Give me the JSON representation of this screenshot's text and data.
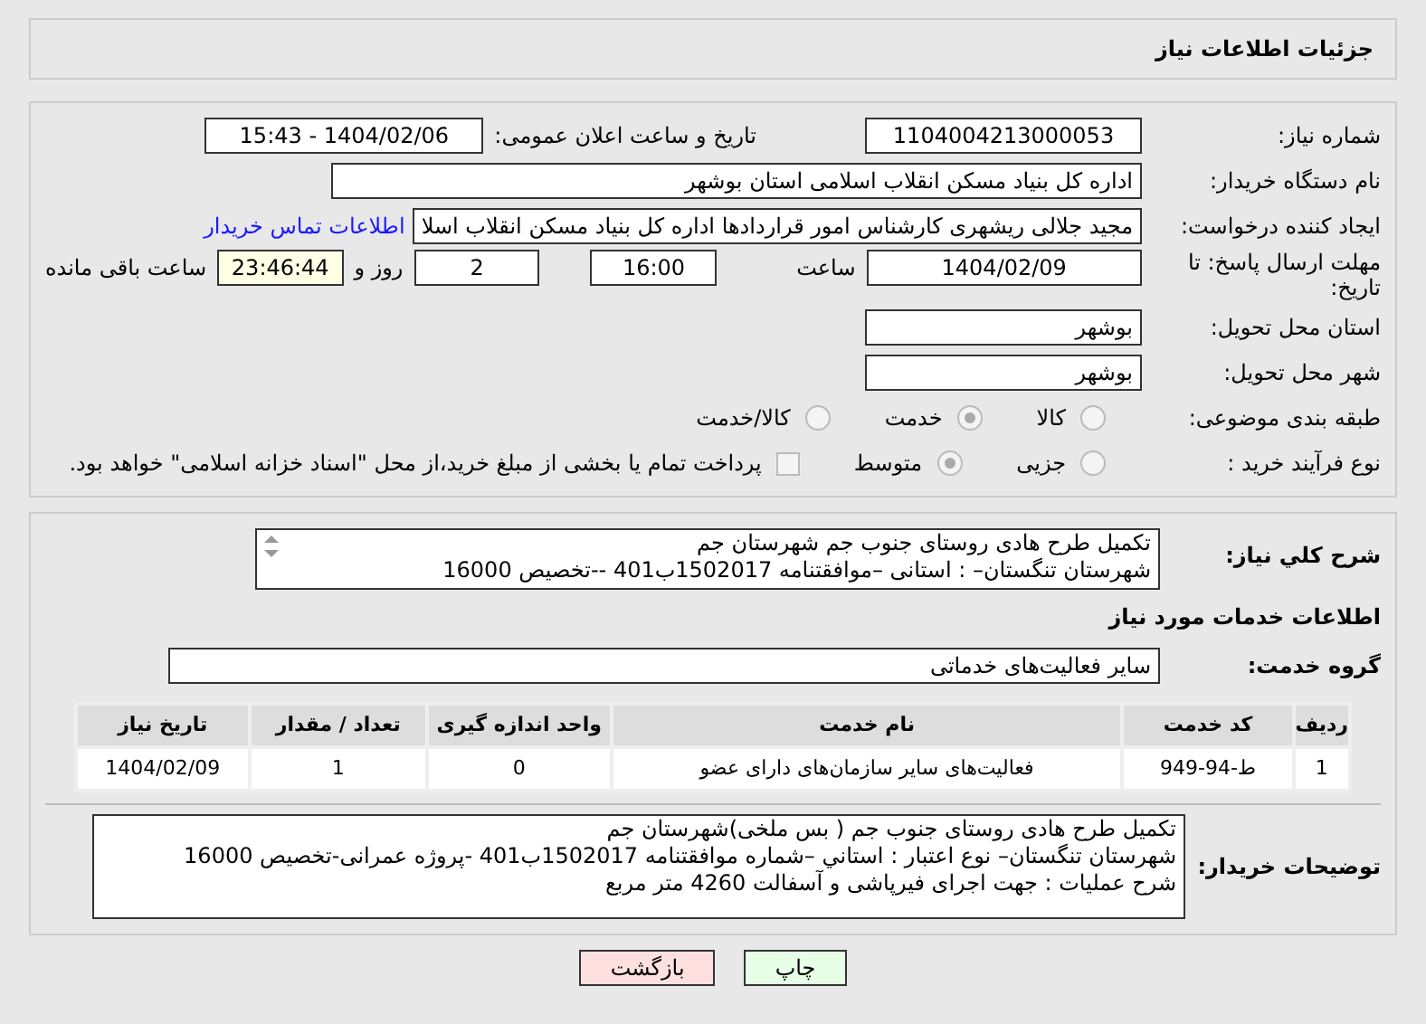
{
  "header": {
    "title": "جزئیات اطلاعات نیاز"
  },
  "fields": {
    "need_number": {
      "label": "شماره نیاز:",
      "value": "1104004213000053"
    },
    "announce": {
      "label": "تاریخ و ساعت اعلان عمومی:",
      "value": "1404/02/06 - 15:43"
    },
    "buyer": {
      "label": "نام دستگاه خریدار:",
      "value": "اداره کل بنیاد مسکن انقلاب اسلامی استان بوشهر"
    },
    "requester": {
      "label": "ایجاد کننده درخواست:",
      "value": "مجید جلالی ریشهری کارشناس امور قراردادها اداره کل بنیاد مسکن انقلاب اسلا",
      "link": "اطلاعات تماس خریدار"
    },
    "deadline": {
      "label": "مهلت ارسال پاسخ: تا تاریخ:",
      "date": "1404/02/09",
      "time_label": "ساعت",
      "time": "16:00",
      "days": "2",
      "days_label": "روز و",
      "remaining": "23:46:44",
      "remaining_label": "ساعت باقی مانده"
    },
    "province": {
      "label": "استان محل تحویل:",
      "value": "بوشهر"
    },
    "city": {
      "label": "شهر محل تحویل:",
      "value": "بوشهر"
    },
    "category": {
      "label": "طبقه بندی موضوعی:",
      "options": [
        {
          "label": "کالا",
          "selected": false
        },
        {
          "label": "خدمت",
          "selected": true
        },
        {
          "label": "کالا/خدمت",
          "selected": false
        }
      ]
    },
    "process": {
      "label": "نوع فرآیند خرید :",
      "options": [
        {
          "label": "جزیی",
          "selected": false
        },
        {
          "label": "متوسط",
          "selected": true
        }
      ],
      "payment": {
        "label": "پرداخت تمام یا بخشی از مبلغ خرید،از محل \"اسناد خزانه اسلامی\" خواهد بود.",
        "checked": false
      }
    }
  },
  "summary": {
    "label": "شرح کلي نياز:",
    "lines": [
      "تکمیل طرح هادی روستای جنوب جم شهرستان جم",
      "شهرستان تنگستان– : استانی –موافقتنامه 1502017ب401 --تخصیص 16000"
    ]
  },
  "services_title": "اطلاعات خدمات مورد نیاز",
  "service_group": {
    "label": "گروه خدمت:",
    "value": "سایر فعالیت‌های خدماتی"
  },
  "table": {
    "columns": [
      "ردیف",
      "کد خدمت",
      "نام خدمت",
      "واحد اندازه گیری",
      "تعداد / مقدار",
      "تاریخ نیاز"
    ],
    "rows": [
      [
        "1",
        "ط-94-949",
        "فعالیت‌های سایر سازمان‌های دارای عضو",
        "0",
        "1",
        "1404/02/09"
      ]
    ]
  },
  "buyer_notes": {
    "label": "توضیحات خریدار:",
    "lines": [
      "تکمیل طرح هادی روستای جنوب جم ( بس ملخی)شهرستان جم",
      "شهرستان تنگستان– نوع اعتبار : استاني –شماره موافقتنامه 1502017ب401 -پروژه عمرانی-تخصیص 16000",
      "شرح عملیات : جهت اجرای فیرپاشی و آسفالت 4260 متر مربع"
    ]
  },
  "buttons": [
    {
      "label": "چاپ",
      "kind": "print"
    },
    {
      "label": "بازگشت",
      "kind": "back"
    }
  ]
}
